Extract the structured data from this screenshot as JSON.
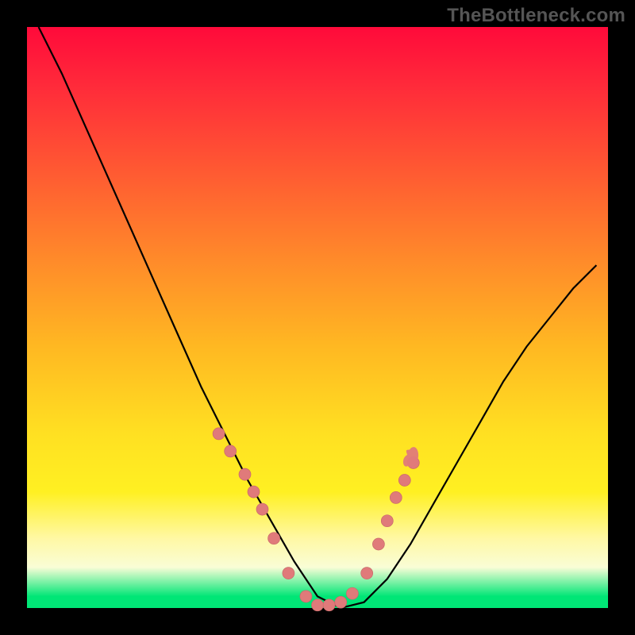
{
  "watermark": "TheBottleneck.com",
  "colors": {
    "dot": "#e07a7a",
    "dot_stroke": "#c96a6a",
    "curve": "#000000"
  },
  "chart_data": {
    "type": "line",
    "title": "",
    "xlabel": "",
    "ylabel": "",
    "xlim": [
      0,
      100
    ],
    "ylim": [
      0,
      100
    ],
    "grid": false,
    "legend": false,
    "series": [
      {
        "name": "curve",
        "x": [
          2,
          6,
          10,
          14,
          18,
          22,
          26,
          30,
          34,
          38,
          42,
          46,
          50,
          54,
          58,
          62,
          66,
          70,
          74,
          78,
          82,
          86,
          90,
          94,
          98
        ],
        "y": [
          100,
          92,
          83,
          74,
          65,
          56,
          47,
          38,
          30,
          22,
          15,
          8,
          2,
          0,
          1,
          5,
          11,
          18,
          25,
          32,
          39,
          45,
          50,
          55,
          59
        ]
      }
    ],
    "markers": {
      "name": "highlighted-points",
      "x": [
        33,
        35,
        37.5,
        39,
        40.5,
        42.5,
        45,
        48,
        50,
        52,
        54,
        56,
        58.5,
        60.5,
        62,
        63.5,
        65,
        66.5
      ],
      "y": [
        30,
        27,
        23,
        20,
        17,
        12,
        6,
        2,
        0.5,
        0.5,
        1,
        2.5,
        6,
        11,
        15,
        19,
        22,
        25
      ]
    },
    "flame_annotation": {
      "x": 66,
      "y": 25
    }
  }
}
